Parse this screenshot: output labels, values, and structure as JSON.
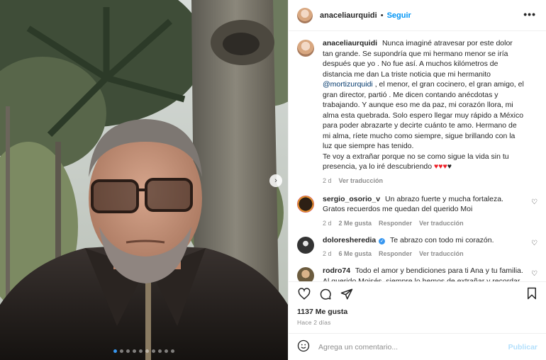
{
  "post": {
    "owner": {
      "username": "anaceliaurquidi",
      "separator": "•",
      "follow_label": "Seguir",
      "more_label": "•••"
    },
    "caption": {
      "username": "anaceliaurquidi",
      "text_before_mention": "Nunca imaginé atravesar por este dolor tan grande. Se supondría que mi hermano menor se iría después que yo . No fue así. A muchos kilómetros de distancia me dan La triste noticia que mi hermanito",
      "mention": "@mortizurquidi",
      "text_after_mention": ", el menor, el gran cocinero, el gran amigo, el gran director, partió . Me dicen contando anécdotas y trabajando. Y aunque eso me da paz, mi corazón llora, mi alma esta quebrada. Solo espero llegar muy rápido a México para poder abrazarte y decirte cuánto te amo. Hermano de mi alma, ríete mucho como siempre, sigue brillando con la luz que siempre has tenido.",
      "text_last": "Te voy a extrañar porque no se como sigue la vida sin tu presencia, ya lo iré descubriendo",
      "hearts_red": "♥♥♥",
      "heart_black": "♥",
      "time": "2 d",
      "translate": "Ver traducción"
    },
    "comments": [
      {
        "username": "sergio_osorio_v",
        "text": "Un abrazo fuerte y mucha fortaleza. Gratos recuerdos me quedan del querido Moi",
        "time": "2 d",
        "likes": "2 Me gusta",
        "reply": "Responder",
        "translate": "Ver traducción"
      },
      {
        "username": "doloresheredia",
        "verified_mark": "✓",
        "text": "Te abrazo con todo mi corazón.",
        "time": "2 d",
        "likes": "6 Me gusta",
        "reply": "Responder",
        "translate": "Ver traducción"
      },
      {
        "username": "rodro74",
        "text": "Todo el amor y bendiciones para ti Ana y tu familia. Al querido Moisés, siempre lo hemos de extrañar y recordar. Vaya un abrazo, amor y solidaridad.",
        "time": "",
        "likes": "",
        "reply": "",
        "translate": ""
      }
    ],
    "likes_count": "1137 Me gusta",
    "posted_ago": "Hace 2 días",
    "add_comment": {
      "placeholder": "Agrega un comentario...",
      "publish_label": "Publicar"
    },
    "carousel": {
      "next_label": "›",
      "total_slides": 10,
      "active_index": 1
    },
    "icons": [
      "heart-icon",
      "comment-icon",
      "share-icon",
      "bookmark-icon",
      "emoji-icon",
      "small-heart-icon"
    ],
    "colors": {
      "link": "#0095f6",
      "mention": "#00376b",
      "secondary_text": "#8e8e8e",
      "publish_disabled": "#b2dffc",
      "active_dot": "#3897f0"
    }
  }
}
